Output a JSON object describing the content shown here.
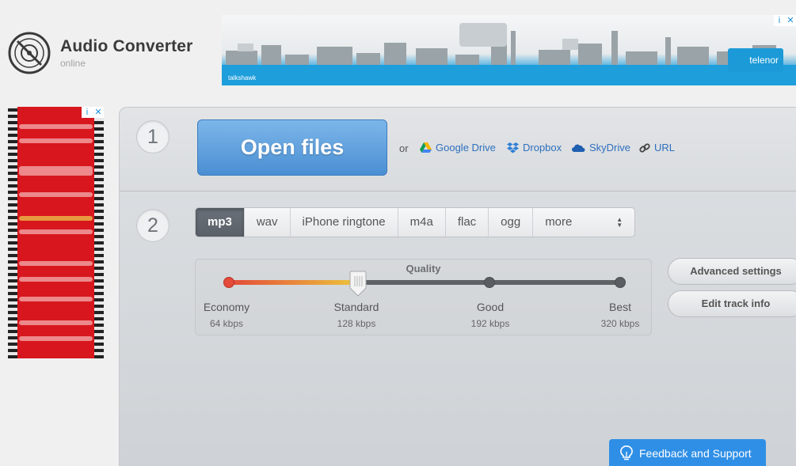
{
  "logo": {
    "title": "Audio Converter",
    "subtitle": "online"
  },
  "top_ad": {
    "left_brand": "talkshawk",
    "right_brand": "telenor",
    "info_mark": "i",
    "close_mark": "✕"
  },
  "side_ad": {
    "info_mark": "i",
    "close_mark": "✕"
  },
  "step1": {
    "number": "1",
    "open_label": "Open files",
    "or_label": "or",
    "sources": [
      {
        "label": "Google Drive",
        "icon": "google-drive-icon"
      },
      {
        "label": "Dropbox",
        "icon": "dropbox-icon"
      },
      {
        "label": "SkyDrive",
        "icon": "skydrive-icon"
      },
      {
        "label": "URL",
        "icon": "link-icon"
      }
    ]
  },
  "step2": {
    "number": "2",
    "formats": [
      "mp3",
      "wav",
      "iPhone ringtone",
      "m4a",
      "flac",
      "ogg",
      "more"
    ],
    "selected_format": "mp3",
    "quality": {
      "title": "Quality",
      "selected_level": "Standard",
      "levels": [
        {
          "name": "Economy",
          "rate": "64 kbps"
        },
        {
          "name": "Standard",
          "rate": "128 kbps"
        },
        {
          "name": "Good",
          "rate": "192 kbps"
        },
        {
          "name": "Best",
          "rate": "320 kbps"
        }
      ]
    },
    "advanced_label": "Advanced settings",
    "edit_label": "Edit track info"
  },
  "feedback_label": "Feedback and Support",
  "colors": {
    "accent_blue": "#4a8fd3",
    "feedback_blue": "#2f8fe6",
    "ad_red": "#d7171d",
    "panel_grey": "#d6d9dc"
  }
}
